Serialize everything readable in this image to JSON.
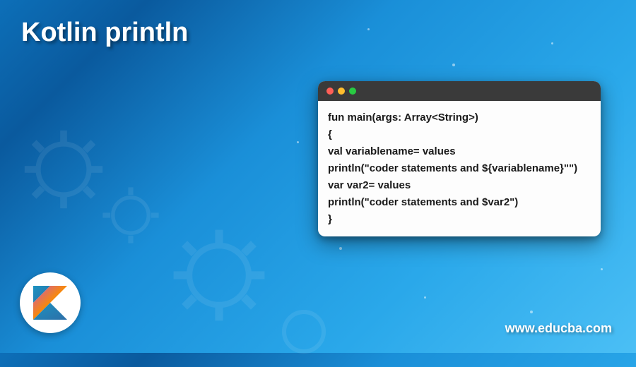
{
  "title": "Kotlin println",
  "window": {
    "dots": [
      "red",
      "yellow",
      "green"
    ]
  },
  "code": {
    "line1": "fun main(args: Array<String>)",
    "line2": "{",
    "line3": "val variablename= values",
    "line4": "println(\"coder statements and ${variablename}\"\")",
    "line5": "var var2= values",
    "line6": "println(\"coder statements and $var2\")",
    "line7": "}"
  },
  "logo": {
    "name": "kotlin-logo"
  },
  "website": "www.educba.com",
  "colors": {
    "bg_start": "#0d6fb8",
    "bg_end": "#4bbff5",
    "title_text": "#ffffff",
    "code_bg": "#fdfdfd",
    "titlebar": "#3a3a3a"
  }
}
